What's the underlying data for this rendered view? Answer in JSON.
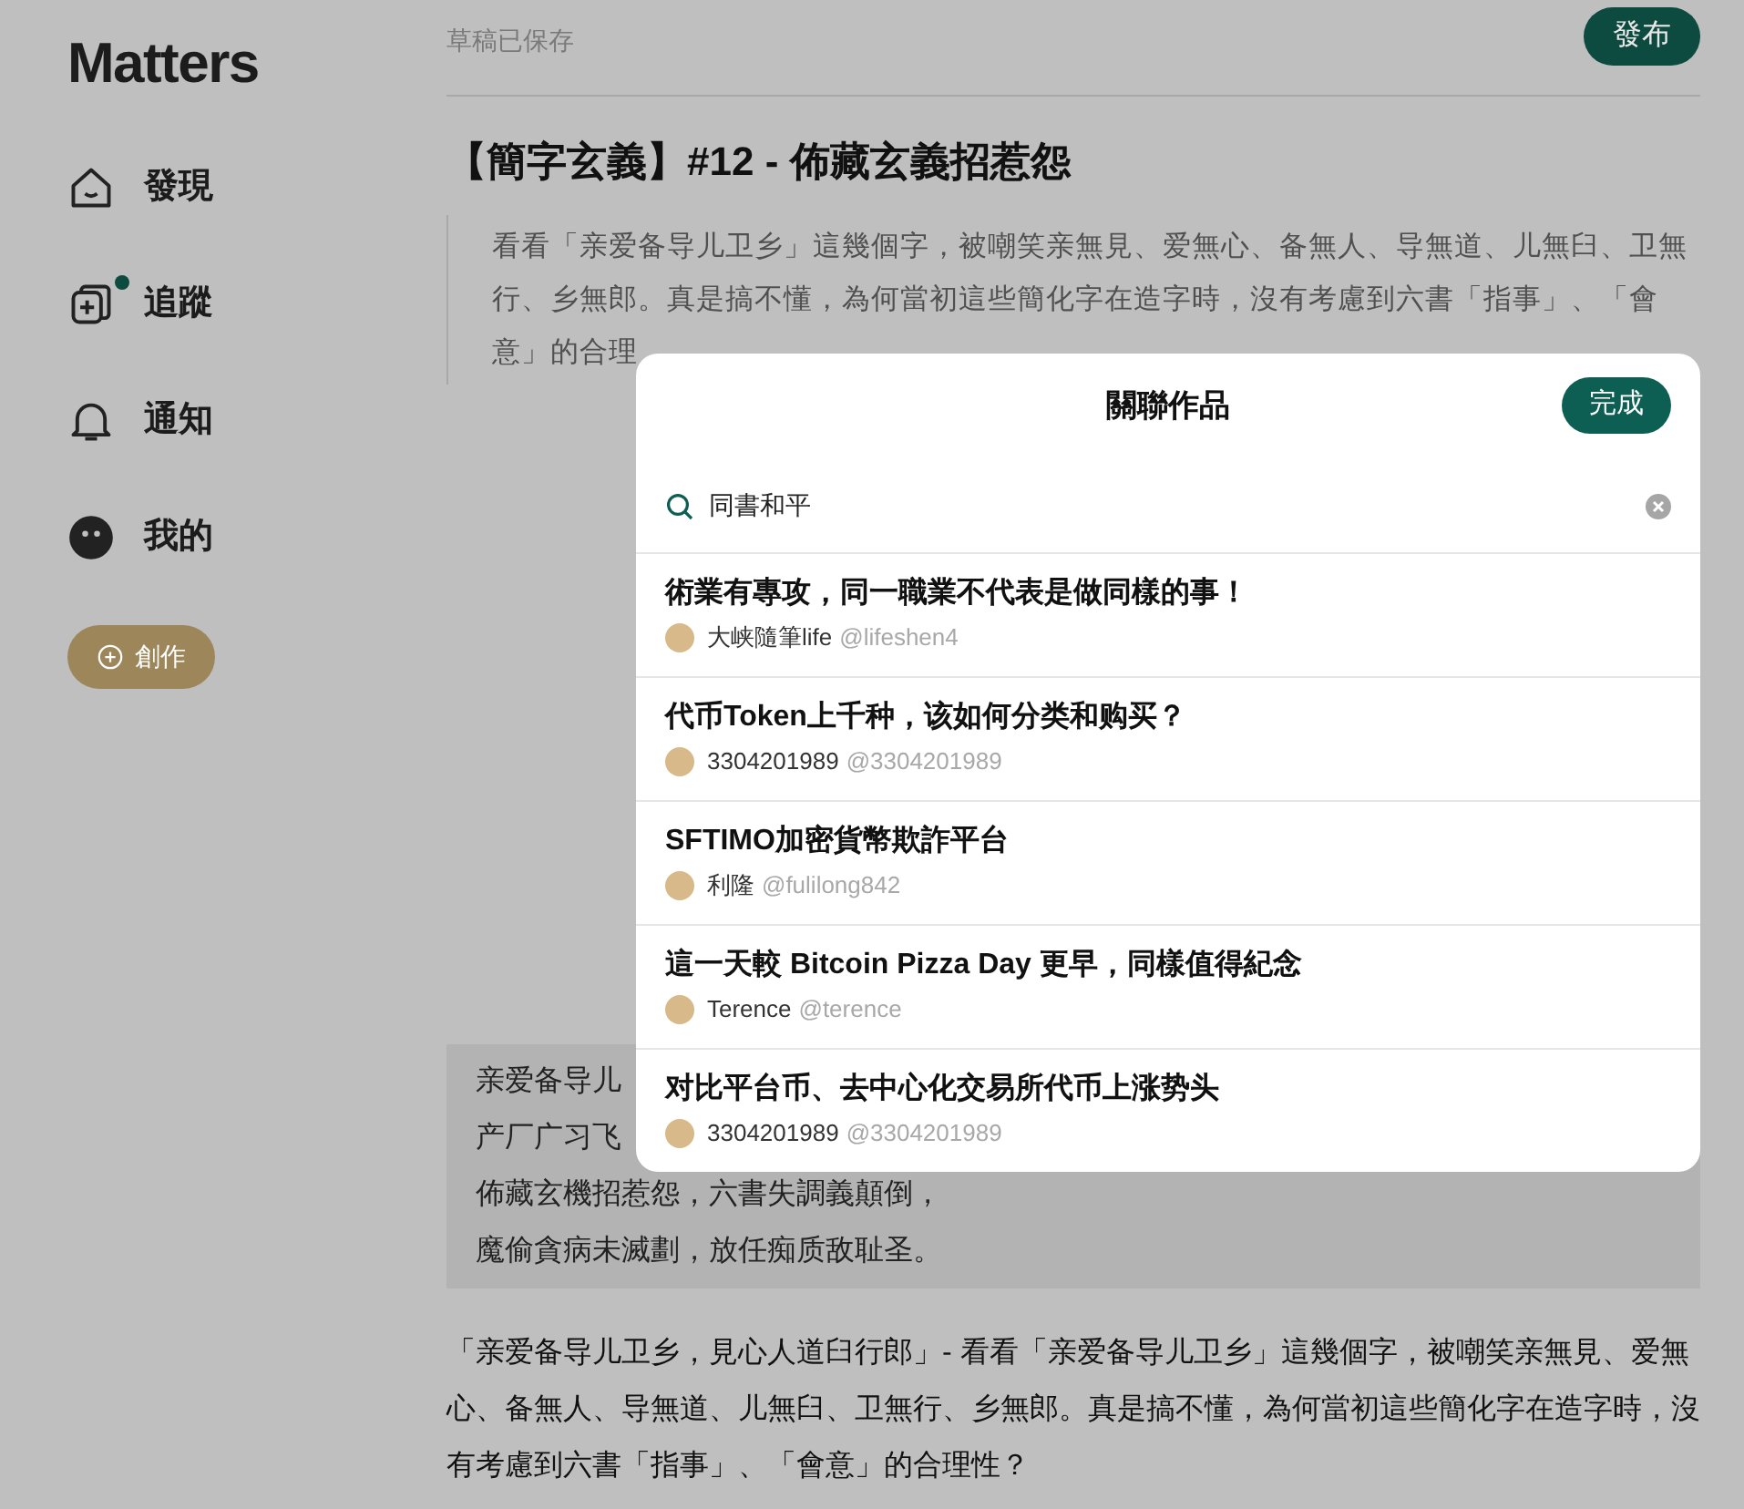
{
  "sidebar": {
    "logo": "Matters",
    "items": [
      {
        "label": "發現",
        "unread": false
      },
      {
        "label": "追蹤",
        "unread": true
      },
      {
        "label": "通知",
        "unread": false
      },
      {
        "label": "我的",
        "unread": false
      }
    ],
    "create_button": "創作"
  },
  "editor": {
    "status": "草稿已保存",
    "publish_button": "發布",
    "title": "【簡字玄義】#12 - 佈藏玄義招惹怨",
    "blockquote_lines": [
      "看看「亲爱备导儿卫乡」這幾個字，被嘲笑亲無見、爱無心、备無人、导無道、儿無臼、卫無",
      "行、乡無郎。真是搞不懂，為何當初這些簡化字在造字時，沒有考慮到六書「指事」、「會",
      "意」的合理"
    ],
    "poem_lines": [
      "亲爱备导儿",
      "产厂广习飞",
      "佈藏玄機招惹怨，六書失調義顛倒，",
      "魔偷貪病未滅劃，放任痴质敌耻圣。"
    ],
    "paragraph_lines": [
      "「亲爱备导儿卫乡，見心人道臼行郎」- 看看「亲爱备导儿卫乡」這幾個字，被嘲笑亲無見、爱無",
      "心、备無人、导無道、儿無臼、卫無行、乡無郎。真是搞不懂，為何當初這些簡化字在造字時，沒",
      "有考慮到六書「指事」、「會意」的合理性？"
    ]
  },
  "dialog": {
    "title": "關聯作品",
    "done_button": "完成",
    "search": {
      "value": "同書和平"
    },
    "results": [
      {
        "title": "術業有專攻，同一職業不代表是做同樣的事！",
        "author": "大峡隨筆life",
        "handle": "@lifeshen4"
      },
      {
        "title": "代币Token上千种，该如何分类和购买？",
        "author": "3304201989",
        "handle": "@3304201989"
      },
      {
        "title": "SFTIMO加密貨幣欺詐平台",
        "author": "利隆",
        "handle": "@fulilong842"
      },
      {
        "title": "這一天較 Bitcoin Pizza Day 更早，同樣值得紀念",
        "author": "Terence",
        "handle": "@terence"
      },
      {
        "title": "对比平台币、去中心化交易所代币上涨势头",
        "author": "3304201989",
        "handle": "@3304201989"
      }
    ]
  }
}
